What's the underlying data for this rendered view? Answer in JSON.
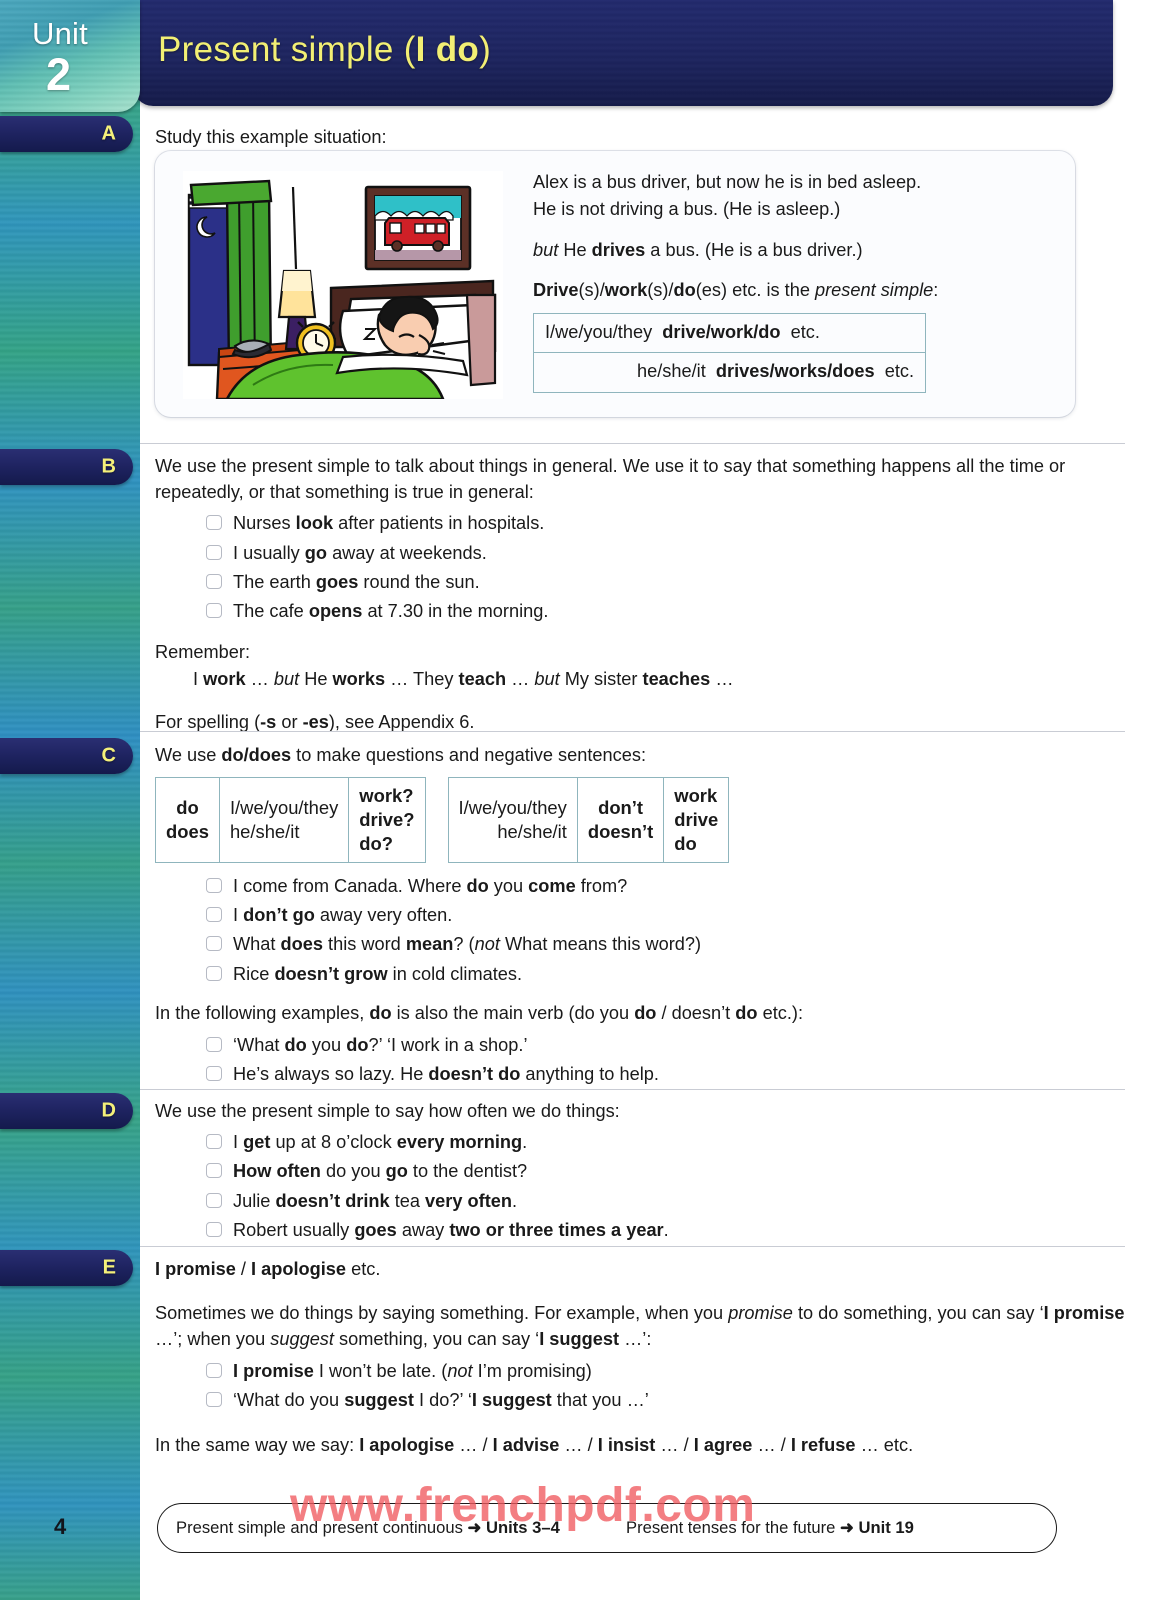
{
  "unit": {
    "word": "Unit",
    "number": "2"
  },
  "header": {
    "title_plain": "Present simple (",
    "title_bold": "I do",
    "title_close": ")"
  },
  "page_number": "4",
  "colors": {
    "title_bar": "#1d245f",
    "title_text": "#f2ef74",
    "sidebar_teal": "#2f94bf",
    "sidebar_green": "#36a488",
    "table_border": "#8fb5bd",
    "watermark": "#f05a5f"
  },
  "sections": {
    "a": {
      "letter": "A",
      "intro": "Study this example situation:",
      "illustration_name": "man-asleep-in-bed-with-bus-picture",
      "lines": [
        "Alex is a bus driver, but now he is in bed asleep.",
        "He is not driving a bus.   (He is asleep.)"
      ],
      "but_line": {
        "but": "but",
        "rest_pre": "  He ",
        "bold": "drives",
        "rest_post": " a bus.   (He is a bus driver.)"
      },
      "form_line": {
        "b1": "Drive",
        "p1": "(s)/",
        "b2": "work",
        "p2": "(s)/",
        "b3": "do",
        "p3": "(es) etc. is the ",
        "i1": "present simple",
        "p4": ":"
      },
      "table": [
        {
          "pronouns": "I/we/you/they",
          "verbs": "drive/work/do",
          "etc": "etc.",
          "align": "left"
        },
        {
          "pronouns": "he/she/it",
          "verbs": "drives/works/does",
          "etc": "etc.",
          "align": "right"
        }
      ]
    },
    "b": {
      "letter": "B",
      "para1": "We use the present simple to talk about things in general.  We use it to say that something happens all the time or repeatedly, or that something is true in general:",
      "examples": [
        {
          "pre": "Nurses ",
          "bold": "look",
          "post": " after patients in hospitals."
        },
        {
          "pre": "I usually ",
          "bold": "go",
          "post": " away at weekends."
        },
        {
          "pre": "The earth ",
          "bold": "goes",
          "post": " round the sun."
        },
        {
          "pre": "The cafe ",
          "bold": "opens",
          "post": " at 7.30 in the morning."
        }
      ],
      "remember_label": "Remember:",
      "remember_line": {
        "a1": "I ",
        "b1": "work",
        "a2": " … ",
        "i1": "but",
        "a3": "  He ",
        "b2": "works",
        "a4": " …       They ",
        "b3": "teach",
        "a5": " … ",
        "i2": "but",
        "a6": "  My sister ",
        "b4": "teaches",
        "a7": " …"
      },
      "spelling_line": {
        "p1": "For spelling (",
        "b1": "-s",
        "p2": " or ",
        "b2": "-es",
        "p3": "), see Appendix 6."
      }
    },
    "c": {
      "letter": "C",
      "intro": {
        "p1": "We use ",
        "b1": "do/does",
        "p2": " to make questions and negative sentences:"
      },
      "question_table": {
        "aux": [
          "do",
          "does"
        ],
        "pronouns": [
          "I/we/you/they",
          "he/she/it"
        ],
        "verbs": [
          "work?",
          "drive?",
          "do?"
        ]
      },
      "negative_table": {
        "pronouns": [
          "I/we/you/they",
          "he/she/it"
        ],
        "aux": [
          "don’t",
          "doesn’t"
        ],
        "verbs": [
          "work",
          "drive",
          "do"
        ]
      },
      "examples": [
        {
          "pre": "I come from Canada.  Where ",
          "bold": "do",
          "mid": " you ",
          "bold2": "come",
          "post": " from?"
        },
        {
          "pre": "I ",
          "bold": "don’t go",
          "post": " away very often."
        },
        {
          "pre": "What ",
          "bold": "does",
          "mid": " this word ",
          "bold2": "mean",
          "post": "?   (",
          "italic": "not",
          "post2": " What means this word?)"
        },
        {
          "pre": "Rice ",
          "bold": "doesn’t grow",
          "post": " in cold climates."
        }
      ],
      "followup": {
        "p1": "In the following examples, ",
        "b1": "do",
        "p2": " is also the main verb (do you ",
        "b2": "do",
        "p3": " / doesn’t ",
        "b3": "do",
        "p4": " etc.):"
      },
      "followup_examples": [
        {
          "pre": "‘What ",
          "bold": "do",
          "mid": " you ",
          "bold2": "do",
          "post": "?’   ‘I work in a shop.’"
        },
        {
          "pre": "He’s always so lazy.  He ",
          "bold": "doesn’t do",
          "post": " anything to help."
        }
      ]
    },
    "d": {
      "letter": "D",
      "intro": "We use the present simple to say how often we do things:",
      "examples": [
        {
          "pre": "I ",
          "bold": "get",
          "mid": " up at 8 o’clock ",
          "bold2": "every morning",
          "post": "."
        },
        {
          "pre": "",
          "bold": "How often",
          "mid": " do you ",
          "bold2": "go",
          "post": " to the dentist?"
        },
        {
          "pre": "Julie ",
          "bold": "doesn’t drink",
          "mid": " tea ",
          "bold2": "very often",
          "post": "."
        },
        {
          "pre": "Robert usually ",
          "bold": "goes",
          "mid": " away ",
          "bold2": "two or three times a year",
          "post": "."
        }
      ]
    },
    "e": {
      "letter": "E",
      "heading": {
        "b1": "I promise",
        "p1": " / ",
        "b2": "I apologise",
        "p2": " etc."
      },
      "para": {
        "p1": "Sometimes we do things by saying something.  For example, when you ",
        "i1": "promise",
        "p2": " to do something, you can say ‘",
        "b1": "I promise",
        "p3": " …’; when you ",
        "i2": "suggest",
        "p4": " something, you can say ‘",
        "b2": "I suggest",
        "p5": " …’:"
      },
      "examples": [
        {
          "pre": "",
          "bold": "I promise",
          "mid": " I won’t be late.   (",
          "italic": "not",
          "post": " I’m promising)"
        },
        {
          "pre": "‘What do you ",
          "bold": "suggest",
          "mid": " I do?’   ‘",
          "bold2": "I suggest",
          "post": " that you …’"
        }
      ],
      "final_line": {
        "p1": "In the same way we say: ",
        "b1": "I apologise",
        "p2": " … / ",
        "b2": "I advise",
        "p3": " … / ",
        "b3": "I insist",
        "p4": " … / ",
        "b4": "I agree",
        "p5": " … / ",
        "b5": "I refuse",
        "p6": " … etc."
      }
    }
  },
  "footer": {
    "ref1": {
      "text": "Present simple and present continuous ",
      "arrow": "➜",
      "target": " Units 3–4"
    },
    "ref2": {
      "text": "Present tenses for the future ",
      "arrow": "➜",
      "target": " Unit 19"
    }
  },
  "watermark": "www.frenchpdf.com"
}
